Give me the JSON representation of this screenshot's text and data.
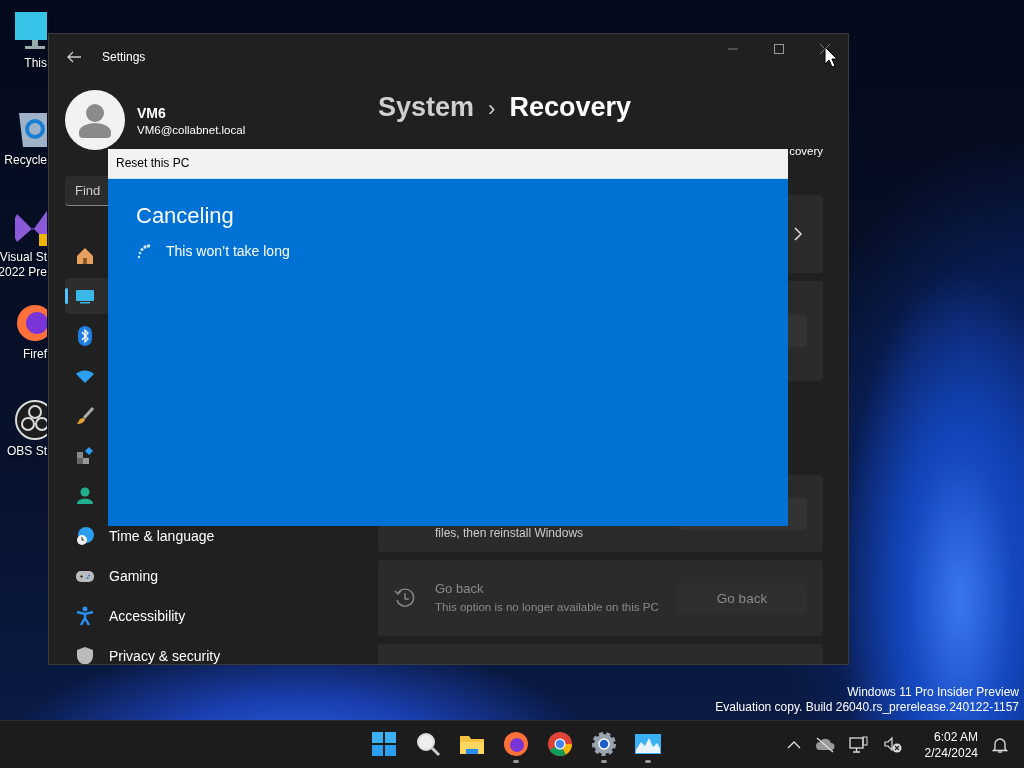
{
  "desktop_icons": [
    {
      "kind": "monitor",
      "labels": [
        "This"
      ]
    },
    {
      "kind": "recycle",
      "labels": [
        "Recycle"
      ]
    },
    {
      "kind": "studio",
      "labels": [
        "Visual St",
        "2022 Pre"
      ]
    },
    {
      "kind": "firefox",
      "labels": [
        "Firef"
      ]
    },
    {
      "kind": "obs",
      "labels": [
        "OBS St"
      ]
    }
  ],
  "watermark": [
    "Windows 11 Pro Insider Preview",
    "Evaluation copy. Build 26040.rs_prerelease.240122-1157"
  ],
  "settings_window": {
    "title": "Settings",
    "user": {
      "name": "VM6",
      "email": "VM6@collabnet.local"
    },
    "search": {
      "placeholder": "Find"
    },
    "nav": [
      {
        "kind": "home",
        "selected": false
      },
      {
        "kind": "system",
        "selected": true
      },
      {
        "kind": "bluetooth",
        "selected": false
      },
      {
        "kind": "network",
        "selected": false
      },
      {
        "kind": "brush",
        "selected": false
      },
      {
        "kind": "apps",
        "selected": false
      },
      {
        "kind": "accounts",
        "selected": false
      },
      {
        "kind": "time",
        "label": "Time & language",
        "selected": false
      },
      {
        "kind": "gaming",
        "label": "Gaming",
        "selected": false
      },
      {
        "kind": "accessibility",
        "label": "Accessibility",
        "selected": false
      },
      {
        "kind": "privacy",
        "label": "Privacy & security",
        "selected": false
      }
    ],
    "breadcrumb": {
      "parent": "System",
      "separator": "›",
      "current": "Recovery"
    },
    "side_text": "covery",
    "cards": [
      {
        "kind": "chevron"
      },
      {
        "kind": "button"
      },
      {
        "kind": "reset",
        "description": "files, then reinstall Windows"
      },
      {
        "kind": "goback",
        "title": "Go back",
        "description": "This option is no longer available on this PC",
        "button": "Go back",
        "disabled": true
      },
      {
        "kind": "header"
      }
    ]
  },
  "dialog": {
    "title": "Reset this PC",
    "heading": "Canceling",
    "status": "This won’t take long"
  },
  "taskbar": {
    "apps": [
      {
        "kind": "start",
        "running": false
      },
      {
        "kind": "search",
        "running": false
      },
      {
        "kind": "explorer",
        "running": false
      },
      {
        "kind": "firefox",
        "running": true
      },
      {
        "kind": "chrome",
        "running": false
      },
      {
        "kind": "settings",
        "running": true
      },
      {
        "kind": "monitor",
        "running": true
      }
    ],
    "time": "6:02 AM",
    "date": "2/24/2024"
  }
}
